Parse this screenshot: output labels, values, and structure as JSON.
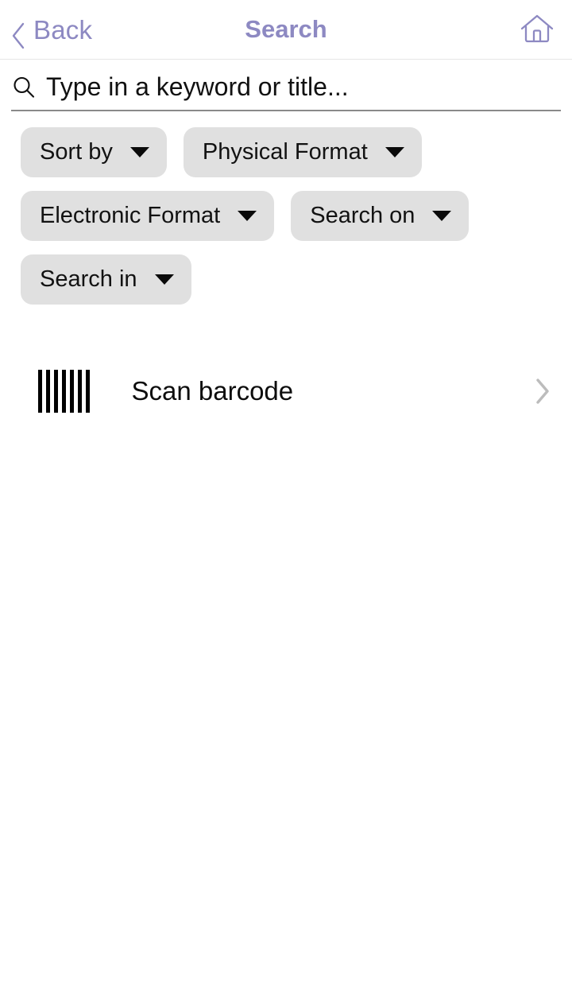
{
  "header": {
    "back_label": "Back",
    "title": "Search",
    "back_icon": "chevron-left-icon",
    "home_icon": "home-icon",
    "accent_color": "#8d89c2"
  },
  "search": {
    "placeholder": "Type in a keyword or title...",
    "value": "",
    "icon": "search-icon"
  },
  "filters": {
    "rows": [
      [
        {
          "label": "Sort by",
          "icon": "chevron-down-icon"
        },
        {
          "label": "Physical Format",
          "icon": "chevron-down-icon"
        }
      ],
      [
        {
          "label": "Electronic Format",
          "icon": "chevron-down-icon"
        },
        {
          "label": "Search on",
          "icon": "chevron-down-icon"
        }
      ],
      [
        {
          "label": "Search in",
          "icon": "chevron-down-icon"
        }
      ]
    ],
    "chip_background": "#e0e0e0"
  },
  "actions": {
    "scan_barcode": {
      "label": "Scan barcode",
      "icon": "barcode-icon",
      "accessory_icon": "chevron-right-icon"
    }
  }
}
